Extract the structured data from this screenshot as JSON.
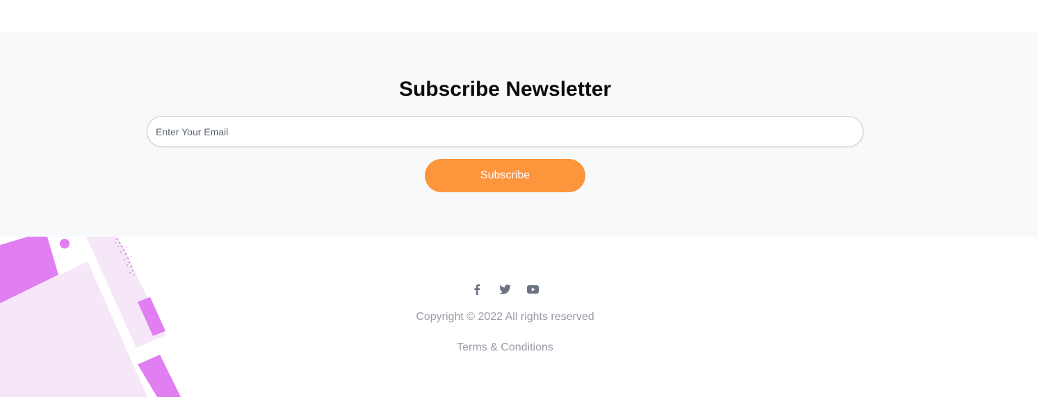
{
  "newsletter": {
    "title": "Subscribe Newsletter",
    "email_placeholder": "Enter Your Email",
    "email_value": "",
    "subscribe_label": "Subscribe"
  },
  "footer": {
    "social": [
      {
        "name": "facebook",
        "icon": "facebook-icon"
      },
      {
        "name": "twitter",
        "icon": "twitter-icon"
      },
      {
        "name": "youtube",
        "icon": "youtube-icon"
      }
    ],
    "copyright": "Copyright © 2022 All rights reserved",
    "terms_label": "Terms & Conditions"
  },
  "colors": {
    "accent": "#fd953d",
    "section_bg": "#f8f9fa",
    "decor_pink": "#e07ef2",
    "decor_light": "#f5e6f8",
    "muted_text": "#999aa6",
    "icon_gray": "#6b7280"
  }
}
